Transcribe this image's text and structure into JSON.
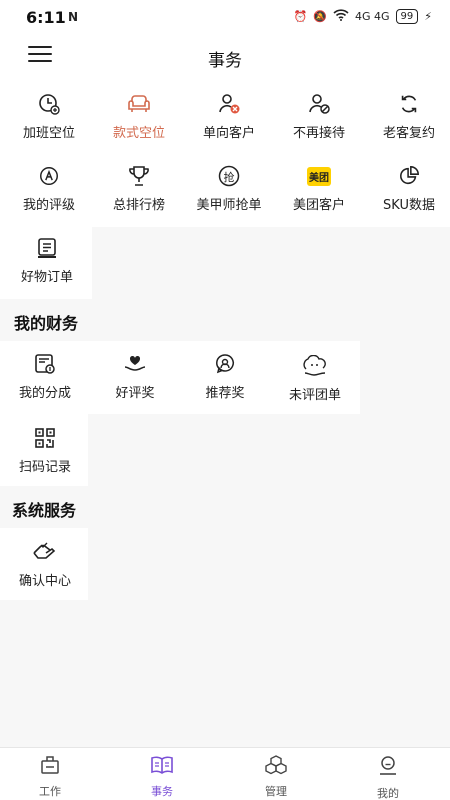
{
  "status_bar": {
    "time": "6:11",
    "nfc": "N",
    "network": "4G 4G",
    "battery": "99",
    "icons": [
      "alarm-icon",
      "mute-icon",
      "wifi-icon",
      "signal-icon",
      "battery-icon",
      "charging-icon"
    ]
  },
  "header": {
    "title": "事务",
    "menu_icon": "menu-icon"
  },
  "grid": {
    "items": [
      {
        "label": "加班空位",
        "icon": "clock-plus-icon"
      },
      {
        "label": "款式空位",
        "icon": "sofa-icon"
      },
      {
        "label": "单向客户",
        "icon": "user-block-icon"
      },
      {
        "label": "不再接待",
        "icon": "user-ban-icon"
      },
      {
        "label": "老客复约",
        "icon": "refresh-icon"
      },
      {
        "label": "我的评级",
        "icon": "grade-a-icon"
      },
      {
        "label": "总排行榜",
        "icon": "trophy-icon"
      },
      {
        "label": "美甲师抢单",
        "icon": "grab-order-icon",
        "badge": "抢"
      },
      {
        "label": "美团客户",
        "icon": "meituan-icon",
        "badge": "美团"
      },
      {
        "label": "SKU数据",
        "icon": "pie-chart-icon"
      },
      {
        "label": "好物订单",
        "icon": "order-list-icon"
      }
    ]
  },
  "finance": {
    "title": "我的财务",
    "items": [
      {
        "label": "我的分成",
        "icon": "commission-icon"
      },
      {
        "label": "好评奖",
        "icon": "heart-hand-icon"
      },
      {
        "label": "推荐奖",
        "icon": "referral-icon"
      },
      {
        "label": "未评团单",
        "icon": "chat-bubble-icon"
      },
      {
        "label": "扫码记录",
        "icon": "qrcode-icon"
      }
    ]
  },
  "system": {
    "title": "系统服务",
    "items": [
      {
        "label": "确认中心",
        "icon": "confirm-hand-icon"
      }
    ]
  },
  "tabbar": {
    "tabs": [
      {
        "label": "工作",
        "icon": "work-icon"
      },
      {
        "label": "事务",
        "icon": "book-icon",
        "active": true
      },
      {
        "label": "管理",
        "icon": "boxes-icon"
      },
      {
        "label": "我的",
        "icon": "profile-icon"
      }
    ]
  },
  "colors": {
    "accent_active": "#d26a4e",
    "tab_active": "#7a4fd6",
    "meituan_yellow": "#ffd100"
  }
}
